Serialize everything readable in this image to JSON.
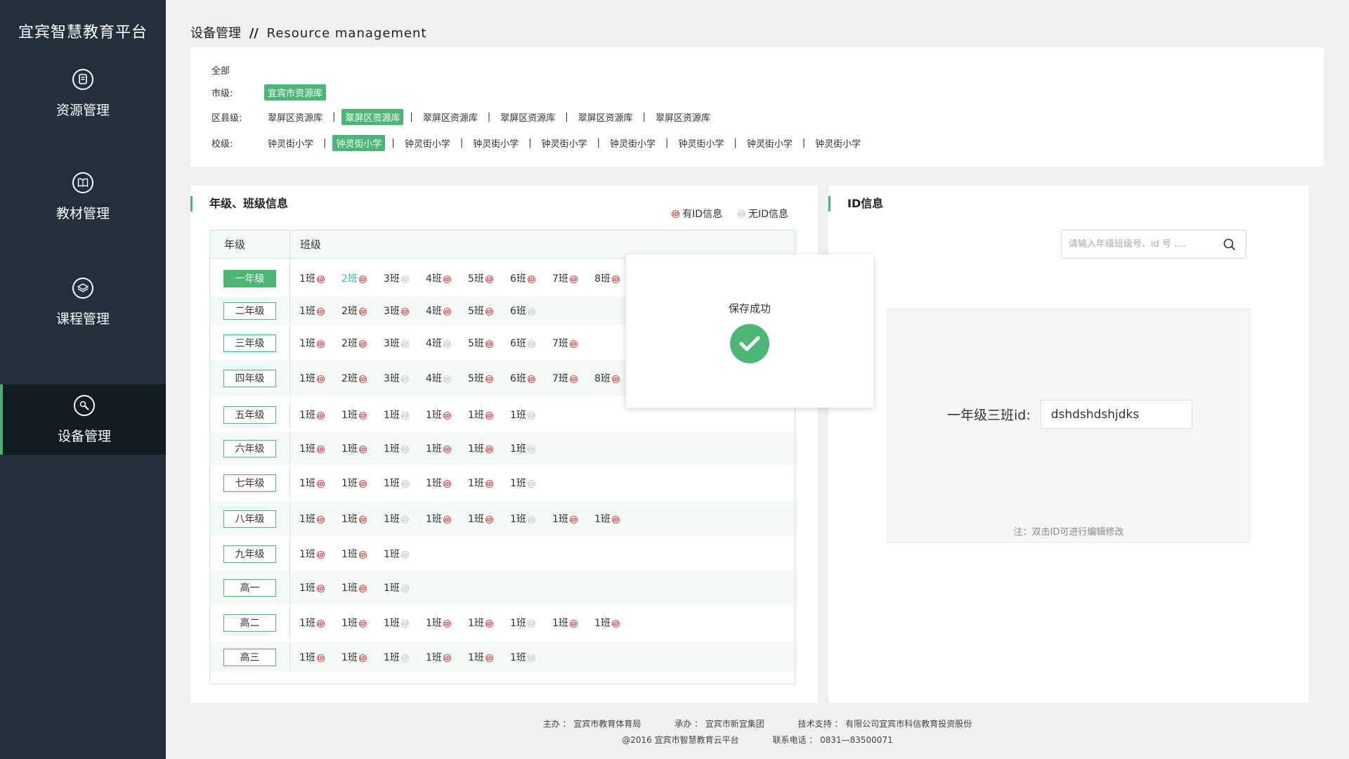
{
  "app": {
    "logo_text": "宜宾智慧教育平台"
  },
  "sidebar": {
    "items": [
      {
        "label": "资源管理",
        "icon": "document-icon"
      },
      {
        "label": "教材管理",
        "icon": "book-icon"
      },
      {
        "label": "课程管理",
        "icon": "layers-icon"
      },
      {
        "label": "设备管理",
        "icon": "wrench-icon",
        "active": true
      }
    ]
  },
  "header": {
    "title_cn": "设备管理",
    "separator": "//",
    "title_en": "Resource management"
  },
  "filters": {
    "all_label": "全部",
    "city": {
      "label": "市级:",
      "options": [
        "宜宾市资源库"
      ],
      "selected": 0
    },
    "county": {
      "label": "区县级:",
      "options": [
        "翠屏区资源库",
        "翠屏区资源库",
        "翠屏区资源库",
        "翠屏区资源库",
        "翠屏区资源库",
        "翠屏区资源库"
      ],
      "selected": 1
    },
    "school": {
      "label": "校级:",
      "options": [
        "钟灵街小学",
        "钟灵街小学",
        "钟灵街小学",
        "钟灵街小学",
        "钟灵街小学",
        "钟灵街小学",
        "钟灵街小学",
        "钟灵街小学",
        "钟灵街小学"
      ],
      "selected": 1
    }
  },
  "grade_panel": {
    "title": "年级、班级信息",
    "legend": {
      "has_id": "有ID信息",
      "no_id": "无ID信息",
      "icon_text": "ID"
    },
    "headers": {
      "grade": "年级",
      "class": "班级"
    },
    "rows": [
      {
        "grade": "一年级",
        "selected": true,
        "classes": [
          [
            "1班",
            true
          ],
          [
            "2班",
            true,
            true
          ],
          [
            "3班",
            false
          ],
          [
            "4班",
            true
          ],
          [
            "5班",
            true
          ],
          [
            "6班",
            true
          ],
          [
            "7班",
            true
          ],
          [
            "8班",
            true
          ]
        ]
      },
      {
        "grade": "二年级",
        "classes": [
          [
            "1班",
            true
          ],
          [
            "2班",
            true
          ],
          [
            "3班",
            true
          ],
          [
            "4班",
            true
          ],
          [
            "5班",
            true
          ],
          [
            "6班",
            false
          ]
        ]
      },
      {
        "grade": "三年级",
        "classes": [
          [
            "1班",
            true
          ],
          [
            "2班",
            true
          ],
          [
            "3班",
            false
          ],
          [
            "4班",
            false
          ],
          [
            "5班",
            true
          ],
          [
            "6班",
            false
          ],
          [
            "7班",
            true
          ]
        ]
      },
      {
        "grade": "四年级",
        "classes": [
          [
            "1班",
            true
          ],
          [
            "2班",
            true
          ],
          [
            "3班",
            false
          ],
          [
            "4班",
            false
          ],
          [
            "5班",
            true
          ],
          [
            "6班",
            true
          ],
          [
            "7班",
            true
          ],
          [
            "8班",
            true
          ]
        ]
      },
      {
        "grade": "五年级",
        "classes": [
          [
            "1班",
            true
          ],
          [
            "1班",
            true
          ],
          [
            "1班",
            false
          ],
          [
            "1班",
            true
          ],
          [
            "1班",
            true
          ],
          [
            "1班",
            false
          ]
        ]
      },
      {
        "grade": "六年级",
        "classes": [
          [
            "1班",
            true
          ],
          [
            "1班",
            true
          ],
          [
            "1班",
            false
          ],
          [
            "1班",
            true
          ],
          [
            "1班",
            true
          ],
          [
            "1班",
            false
          ]
        ]
      },
      {
        "grade": "七年级",
        "classes": [
          [
            "1班",
            true
          ],
          [
            "1班",
            true
          ],
          [
            "1班",
            false
          ],
          [
            "1班",
            true
          ],
          [
            "1班",
            true
          ],
          [
            "1班",
            false
          ]
        ]
      },
      {
        "grade": "八年级",
        "classes": [
          [
            "1班",
            true
          ],
          [
            "1班",
            true
          ],
          [
            "1班",
            false
          ],
          [
            "1班",
            true
          ],
          [
            "1班",
            true
          ],
          [
            "1班",
            false
          ],
          [
            "1班",
            true
          ],
          [
            "1班",
            true
          ]
        ]
      },
      {
        "grade": "九年级",
        "classes": [
          [
            "1班",
            true
          ],
          [
            "1班",
            true
          ],
          [
            "1班",
            false
          ]
        ]
      },
      {
        "grade": "高一",
        "classes": [
          [
            "1班",
            true
          ],
          [
            "1班",
            true
          ],
          [
            "1班",
            false
          ]
        ]
      },
      {
        "grade": "高二",
        "classes": [
          [
            "1班",
            true
          ],
          [
            "1班",
            true
          ],
          [
            "1班",
            false
          ],
          [
            "1班",
            true
          ],
          [
            "1班",
            true
          ],
          [
            "1班",
            false
          ],
          [
            "1班",
            true
          ],
          [
            "1班",
            true
          ]
        ]
      },
      {
        "grade": "高三",
        "classes": [
          [
            "1班",
            true
          ],
          [
            "1班",
            true
          ],
          [
            "1班",
            false
          ],
          [
            "1班",
            true
          ],
          [
            "1班",
            true
          ],
          [
            "1班",
            false
          ]
        ]
      }
    ]
  },
  "popup": {
    "message": "保存成功",
    "icon": "check-icon"
  },
  "id_panel": {
    "title": "ID信息",
    "search": {
      "placeholder": "请输入年级班级号、id 号 ....",
      "value": ""
    },
    "field_label": "一年级三班id:",
    "field_value": "dshdshdshjdks",
    "note": "注：双击ID可进行编辑修改"
  },
  "footer": {
    "line1": [
      "主办 ： 宜宾市教育体育局",
      "承办 ： 宜宾市新宜集团",
      "技术支持 ： 有限公司宜宾市科信教育投资股份"
    ],
    "line2": [
      "@2016   宜宾市智慧教育云平台",
      "联系电话 ： 0831—83500071"
    ]
  },
  "colors": {
    "accent": "#4cb774",
    "sidebar": "#21303c",
    "has_id": "#e04646",
    "no_id": "#c8c8c8",
    "selected_class": "#36b3c8"
  }
}
